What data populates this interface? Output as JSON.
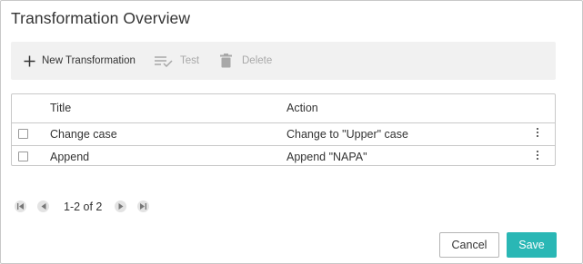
{
  "dialog": {
    "title": "Transformation Overview"
  },
  "toolbar": {
    "new_label": "New Transformation",
    "new_icon": "plus-icon",
    "test_label": "Test",
    "test_icon": "checklist-icon",
    "delete_label": "Delete",
    "delete_icon": "trash-icon"
  },
  "table": {
    "headers": {
      "title": "Title",
      "action": "Action"
    },
    "rows": [
      {
        "title": "Change case",
        "action": "Change to \"Upper\" case"
      },
      {
        "title": "Append",
        "action": "Append \"NAPA\""
      }
    ]
  },
  "pager": {
    "text": "1-2 of 2"
  },
  "footer": {
    "cancel_label": "Cancel",
    "save_label": "Save"
  },
  "colors": {
    "accent": "#2ab7b5",
    "toolbar_bg": "#f1f1f1",
    "disabled": "#a8a8a8"
  }
}
